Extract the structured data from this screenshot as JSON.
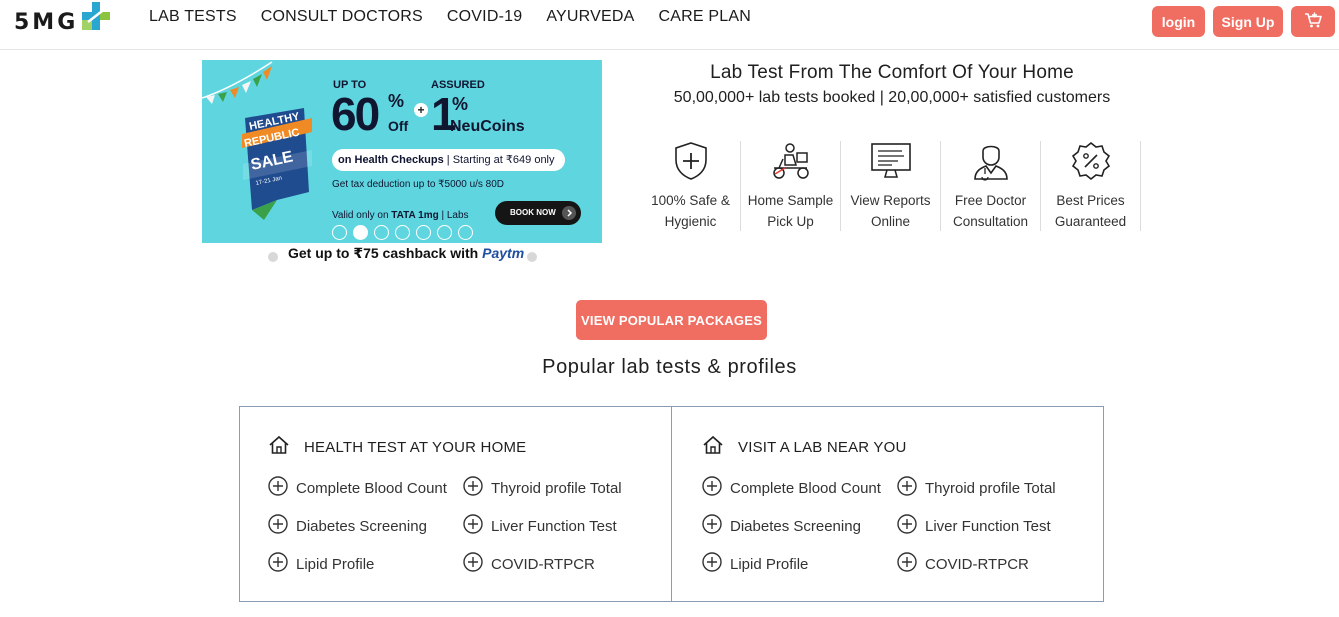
{
  "brand": {
    "logo_text": "5MG"
  },
  "nav": {
    "links": [
      "LAB TESTS",
      "CONSULT DOCTORS",
      "COVID-19",
      "AYURVEDA",
      "CARE PLAN"
    ],
    "login_label": "login",
    "signup_label": "Sign Up",
    "cart_icon": "cart-icon"
  },
  "banner": {
    "sale_line1": "HEALTHY",
    "sale_line2": "REPUBLIC",
    "sale_line3": "SALE",
    "sale_dates": "17-21 Jan",
    "up_to": "UP TO",
    "discount_value": "60",
    "percent": "%",
    "off": "Off",
    "plus": "+",
    "assured": "ASSURED",
    "assured_value": "1",
    "assured_percent": "%",
    "neucoins": "NeuCoins",
    "pill_bold": "on Health Checkups",
    "pill_rest": " | Starting at ₹649 only",
    "tax": "Get tax deduction up to ₹5000 u/s 80D",
    "valid_prefix": "Valid only on ",
    "valid_brand": "TATA 1mg",
    "valid_suffix": " | Labs",
    "book_now": "BOOK NOW",
    "slide_count": 7,
    "active_slide": 1,
    "cashback_text": "Get up to ₹75 cashback with ",
    "cashback_brand": "Paytm"
  },
  "info": {
    "title": "Lab Test From The Comfort Of Your Home",
    "subtitle": "50,00,000+ lab tests booked | 20,00,000+ satisfied customers",
    "features": [
      {
        "icon": "shield-plus-icon",
        "line1": "100% Safe &",
        "line2": "Hygienic"
      },
      {
        "icon": "delivery-scooter-icon",
        "line1": "Home Sample",
        "line2": "Pick Up"
      },
      {
        "icon": "monitor-report-icon",
        "line1": "View Reports",
        "line2": "Online"
      },
      {
        "icon": "doctor-icon",
        "line1": "Free Doctor",
        "line2": "Consultation"
      },
      {
        "icon": "discount-badge-icon",
        "line1": "Best Prices",
        "line2": "Guaranteed"
      }
    ]
  },
  "cta": {
    "label": "VIEW POPULAR PACKAGES"
  },
  "popular": {
    "title": "Popular lab tests & profiles",
    "panels": [
      {
        "icon": "home-icon",
        "title": "HEALTH TEST AT YOUR HOME",
        "tests": [
          "Complete Blood Count",
          "Thyroid profile Total",
          "Diabetes Screening",
          "Liver Function Test",
          "Lipid Profile",
          "COVID-RTPCR"
        ]
      },
      {
        "icon": "home-icon",
        "title": "VISIT A LAB NEAR YOU",
        "tests": [
          "Complete Blood Count",
          "Thyroid profile Total",
          "Diabetes Screening",
          "Liver Function Test",
          "Lipid Profile",
          "COVID-RTPCR"
        ]
      }
    ]
  },
  "colors": {
    "accent": "#f06d61",
    "banner_bg": "#5fd6df",
    "box_border": "#8a9bb3"
  }
}
